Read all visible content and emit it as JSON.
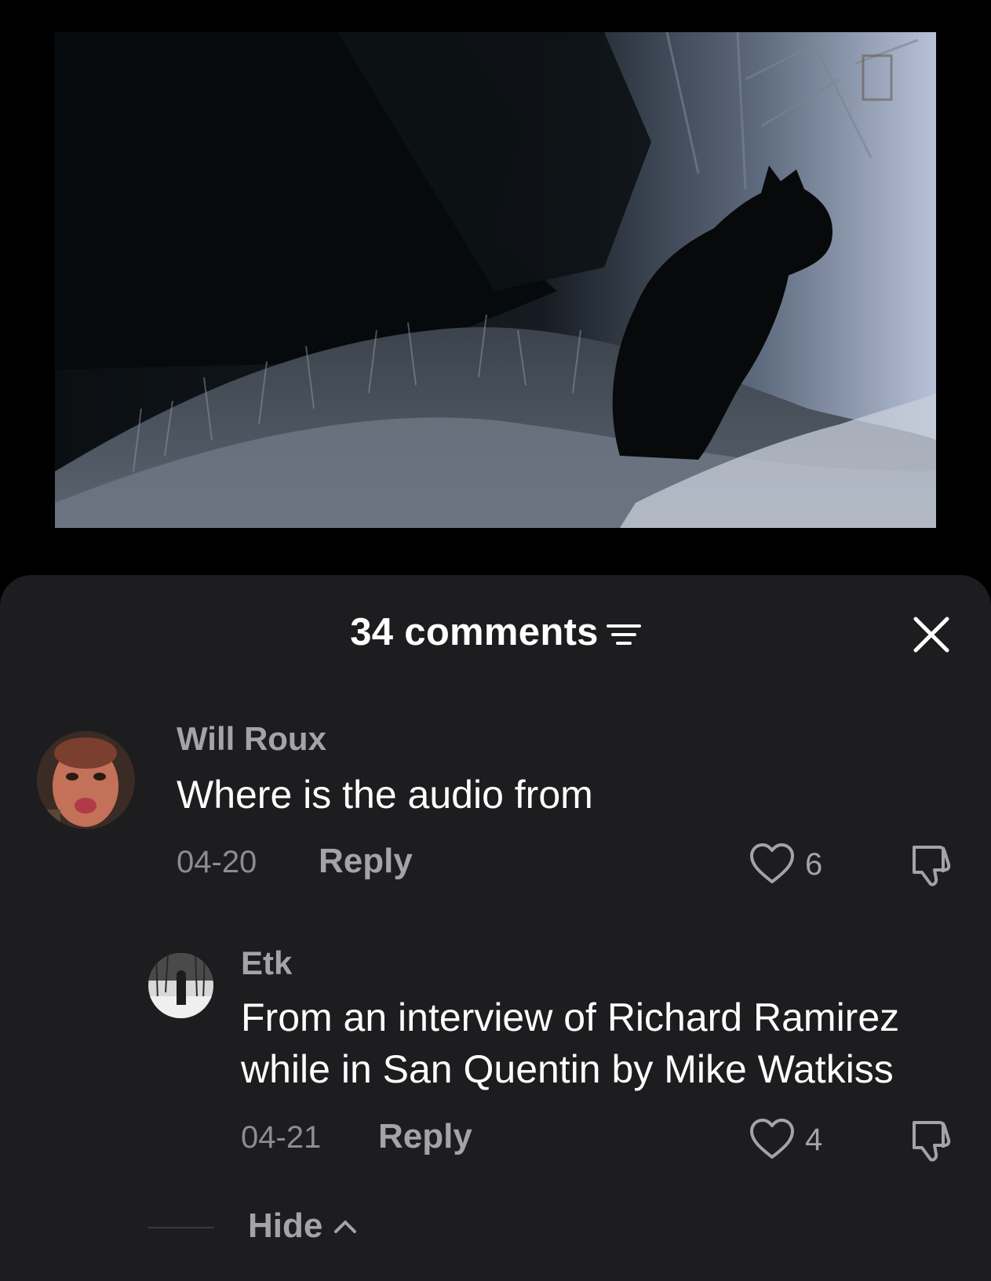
{
  "video": {
    "scene_icon": "bear-silhouette-video-frame"
  },
  "comments_header": {
    "count_label": "34 comments",
    "sort_icon": "sort-filter-icon",
    "close_icon": "close-icon"
  },
  "comments": [
    {
      "username": "Will Roux",
      "text": "Where is the audio from",
      "date": "04-20",
      "reply_label": "Reply",
      "likes": "6"
    }
  ],
  "replies": [
    {
      "username": "Etk",
      "text_line1": "From an interview of Richard Ramirez",
      "text_line2": "while in San Quentin by Mike Watkiss",
      "date": "04-21",
      "reply_label": "Reply",
      "likes": "4"
    }
  ],
  "hide_toggle": {
    "label": "Hide"
  },
  "colors": {
    "sheet_background": "#1d1d1f",
    "page_background": "#000000",
    "primary_text": "#ffffff",
    "secondary_text": "#a4a4a6"
  }
}
